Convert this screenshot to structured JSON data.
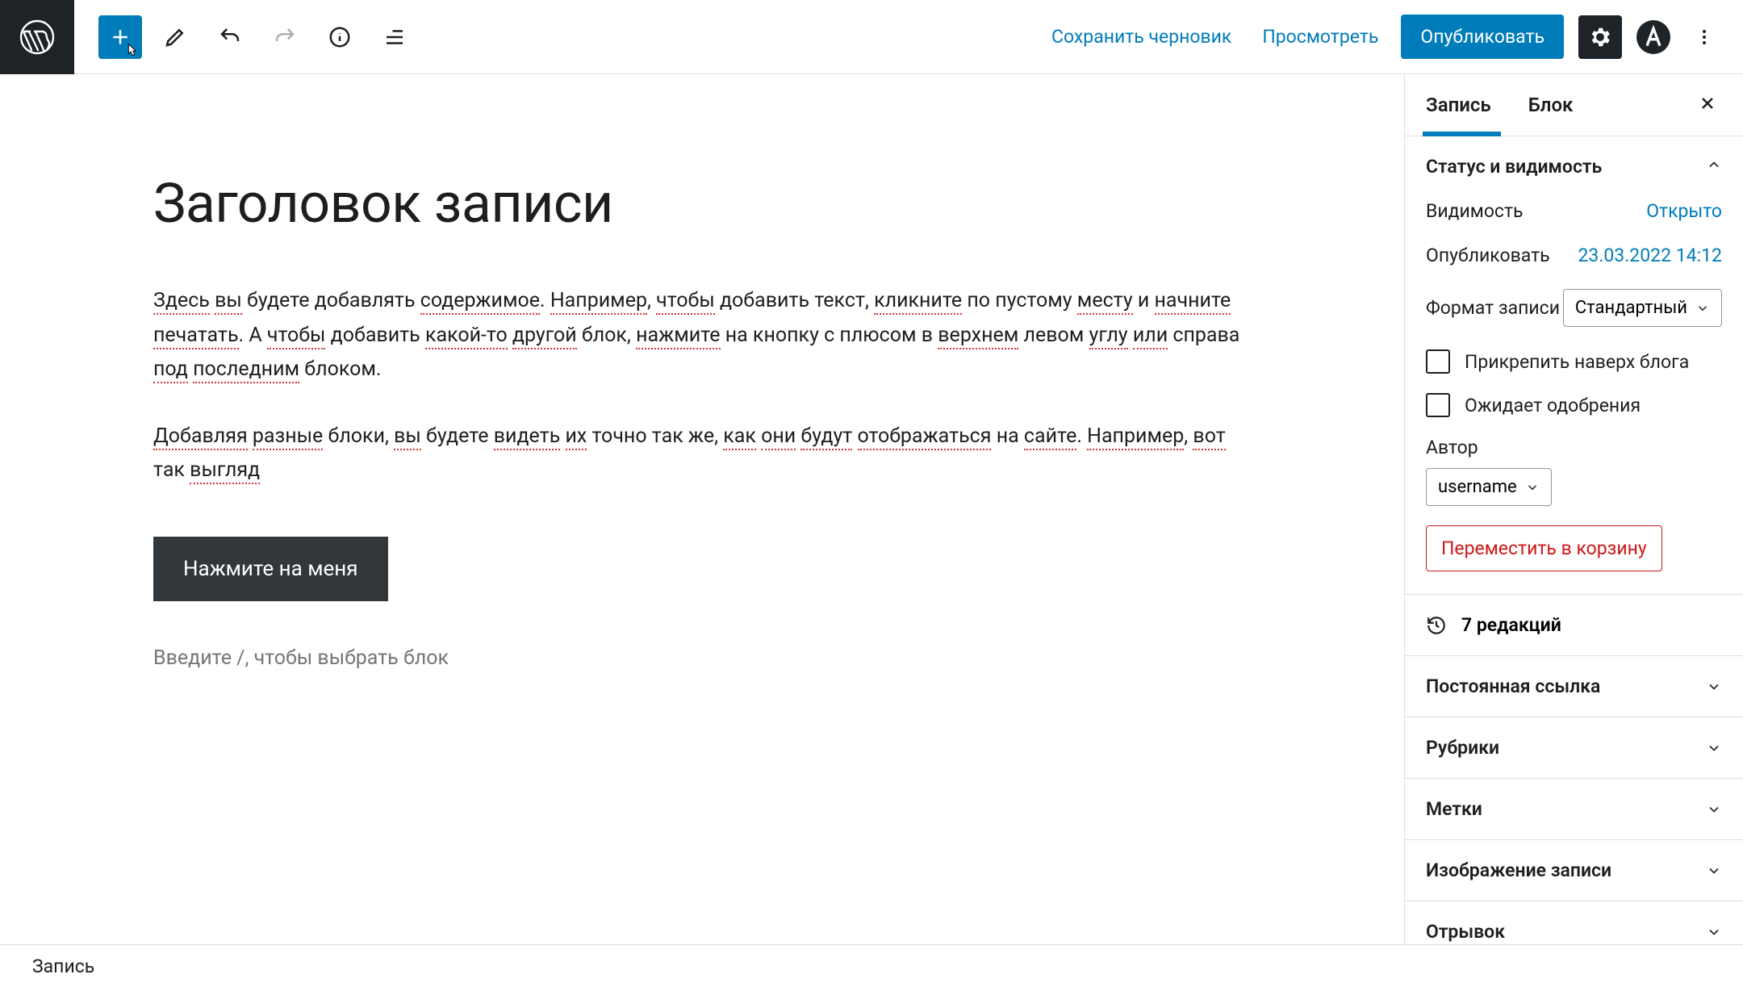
{
  "toolbar": {
    "save_draft": "Сохранить черновик",
    "preview": "Просмотреть",
    "publish": "Опубликовать"
  },
  "post": {
    "title": "Заголовок записи",
    "p1_parts": [
      "Здесь",
      "вы",
      "будете добавлять",
      "содержимое",
      ".",
      "Например",
      ",",
      "чтобы",
      "добавить текст,",
      "кликните",
      "по пустому",
      "месту",
      "и",
      "начните",
      "печатать",
      ". А",
      "чтобы",
      "добавить",
      "какой-то",
      "другой",
      "блок,",
      "нажмите",
      "на кнопку с плюсом в",
      "верхнем",
      "левом",
      "углу",
      "или",
      "справа",
      "под",
      "последним",
      "блоком."
    ],
    "p2_parts": [
      "Добавляя",
      "разные",
      "блоки,",
      "вы",
      "будете",
      "видеть",
      "их",
      "точно так же,",
      "как",
      "они",
      "будут",
      "отображаться",
      "на",
      "сайте",
      ".",
      "Например",
      ",",
      "вот",
      "так",
      "выгляд"
    ],
    "cta": "Нажмите на меня",
    "placeholder": "Введите /, чтобы выбрать блок"
  },
  "sidebar": {
    "tabs": {
      "post": "Запись",
      "block": "Блок"
    },
    "status_panel": {
      "title": "Статус и видимость",
      "visibility_label": "Видимость",
      "visibility_value": "Открыто",
      "publish_label": "Опубликовать",
      "publish_value": "23.03.2022 14:12",
      "format_label": "Формат записи",
      "format_value": "Стандартный",
      "sticky_label": "Прикрепить наверх блога",
      "pending_label": "Ожидает одобрения",
      "author_label": "Автор",
      "author_value": "username",
      "trash": "Переместить в корзину"
    },
    "revisions": "7 редакций",
    "panels": {
      "permalink": "Постоянная ссылка",
      "categories": "Рубрики",
      "tags": "Метки",
      "featured": "Изображение записи",
      "excerpt": "Отрывок"
    }
  },
  "statusbar": "Запись"
}
